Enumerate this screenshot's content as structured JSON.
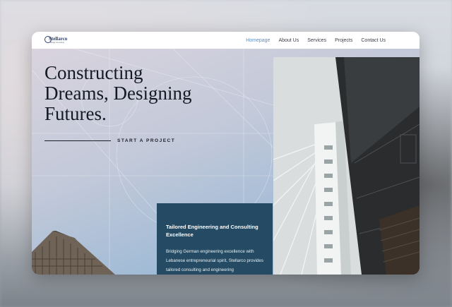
{
  "site": {
    "logo": {
      "name": "Stellarco",
      "tagline": "Bridge Consulting"
    }
  },
  "nav": {
    "items": [
      {
        "label": "Homepage",
        "active": true
      },
      {
        "label": "About Us",
        "active": false
      },
      {
        "label": "Services",
        "active": false
      },
      {
        "label": "Projects",
        "active": false
      },
      {
        "label": "Contact Us",
        "active": false
      }
    ]
  },
  "hero": {
    "headline_lines": [
      "Constructing",
      "Dreams, Designing",
      "Futures."
    ],
    "cta_label": "START A PROJECT"
  },
  "card": {
    "title": "Tailored Engineering and Consulting Excellence",
    "body": "Bridging German engineering excellence with Lebanese entrepreneurial spirit, Stellarco provides tailored consulting and engineering"
  },
  "colors": {
    "accent_nav": "#5a8fc8",
    "card_bg": "#244b63",
    "headline": "#141a24"
  },
  "icons": [
    "logo-mark-icon"
  ]
}
